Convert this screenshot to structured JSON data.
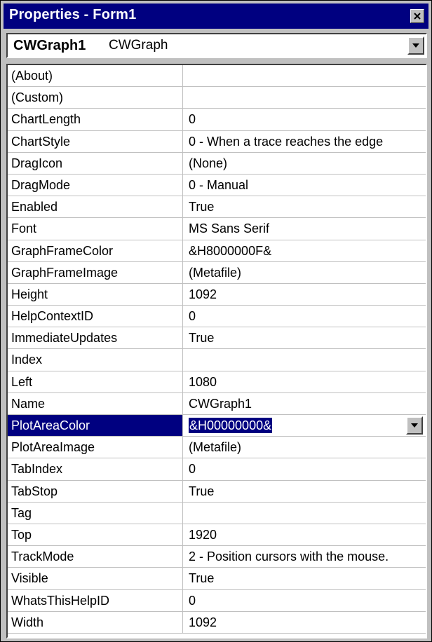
{
  "window": {
    "title": "Properties - Form1"
  },
  "object_selector": {
    "name": "CWGraph1",
    "type": "CWGraph"
  },
  "properties": [
    {
      "name": "(About)",
      "value": ""
    },
    {
      "name": "(Custom)",
      "value": ""
    },
    {
      "name": "ChartLength",
      "value": "0"
    },
    {
      "name": "ChartStyle",
      "value": "0 - When a trace reaches the edge"
    },
    {
      "name": "DragIcon",
      "value": "(None)"
    },
    {
      "name": "DragMode",
      "value": "0 - Manual"
    },
    {
      "name": "Enabled",
      "value": "True"
    },
    {
      "name": "Font",
      "value": "MS Sans Serif"
    },
    {
      "name": "GraphFrameColor",
      "value": "&H8000000F&"
    },
    {
      "name": "GraphFrameImage",
      "value": "(Metafile)"
    },
    {
      "name": "Height",
      "value": "1092"
    },
    {
      "name": "HelpContextID",
      "value": "0"
    },
    {
      "name": "ImmediateUpdates",
      "value": "True"
    },
    {
      "name": "Index",
      "value": ""
    },
    {
      "name": "Left",
      "value": "1080"
    },
    {
      "name": "Name",
      "value": "CWGraph1"
    },
    {
      "name": "PlotAreaColor",
      "value": "&H00000000&",
      "selected": true
    },
    {
      "name": "PlotAreaImage",
      "value": "(Metafile)"
    },
    {
      "name": "TabIndex",
      "value": "0"
    },
    {
      "name": "TabStop",
      "value": "True"
    },
    {
      "name": "Tag",
      "value": ""
    },
    {
      "name": "Top",
      "value": "1920"
    },
    {
      "name": "TrackMode",
      "value": "2 - Position cursors with the mouse."
    },
    {
      "name": "Visible",
      "value": "True"
    },
    {
      "name": "WhatsThisHelpID",
      "value": "0"
    },
    {
      "name": "Width",
      "value": "1092"
    }
  ],
  "colors": {
    "title_bar": "#000080",
    "selection": "#000080",
    "chrome": "#c0c0c0",
    "grid_line": "#c0c0c0"
  },
  "icons": {
    "close": "close-icon",
    "dropdown": "chevron-down-icon"
  }
}
